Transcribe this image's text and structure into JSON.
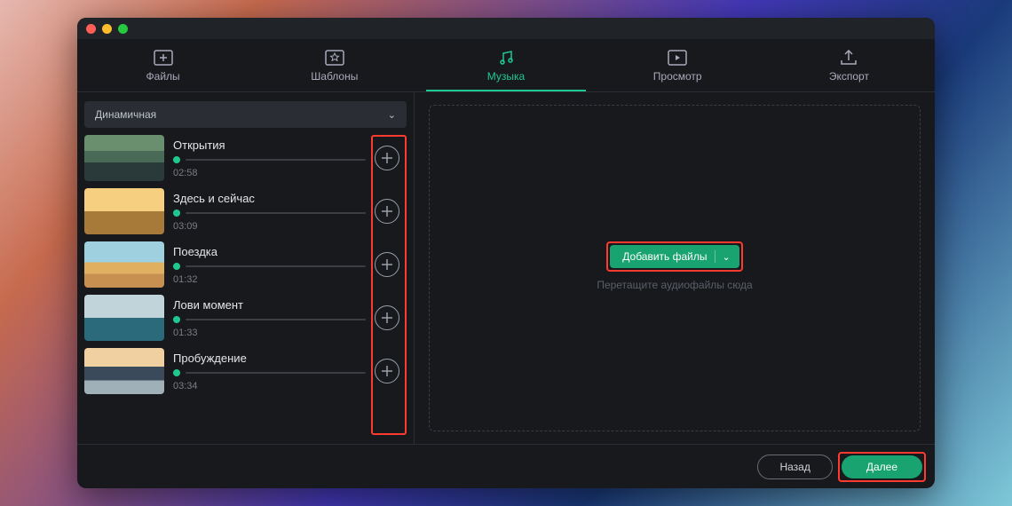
{
  "tabs": {
    "files": {
      "label": "Файлы"
    },
    "templates": {
      "label": "Шаблоны"
    },
    "music": {
      "label": "Музыка",
      "active": true
    },
    "preview": {
      "label": "Просмотр"
    },
    "export": {
      "label": "Экспорт"
    }
  },
  "category": {
    "selected": "Динамичная"
  },
  "tracks": [
    {
      "title": "Открытия",
      "duration": "02:58"
    },
    {
      "title": "Здесь и сейчас",
      "duration": "03:09"
    },
    {
      "title": "Поездка",
      "duration": "01:32"
    },
    {
      "title": "Лови момент",
      "duration": "01:33"
    },
    {
      "title": "Пробуждение",
      "duration": "03:34"
    }
  ],
  "dropzone": {
    "add_files_label": "Добавить файлы",
    "hint": "Перетащите аудиофайлы сюда"
  },
  "footer": {
    "back": "Назад",
    "next": "Далее"
  }
}
